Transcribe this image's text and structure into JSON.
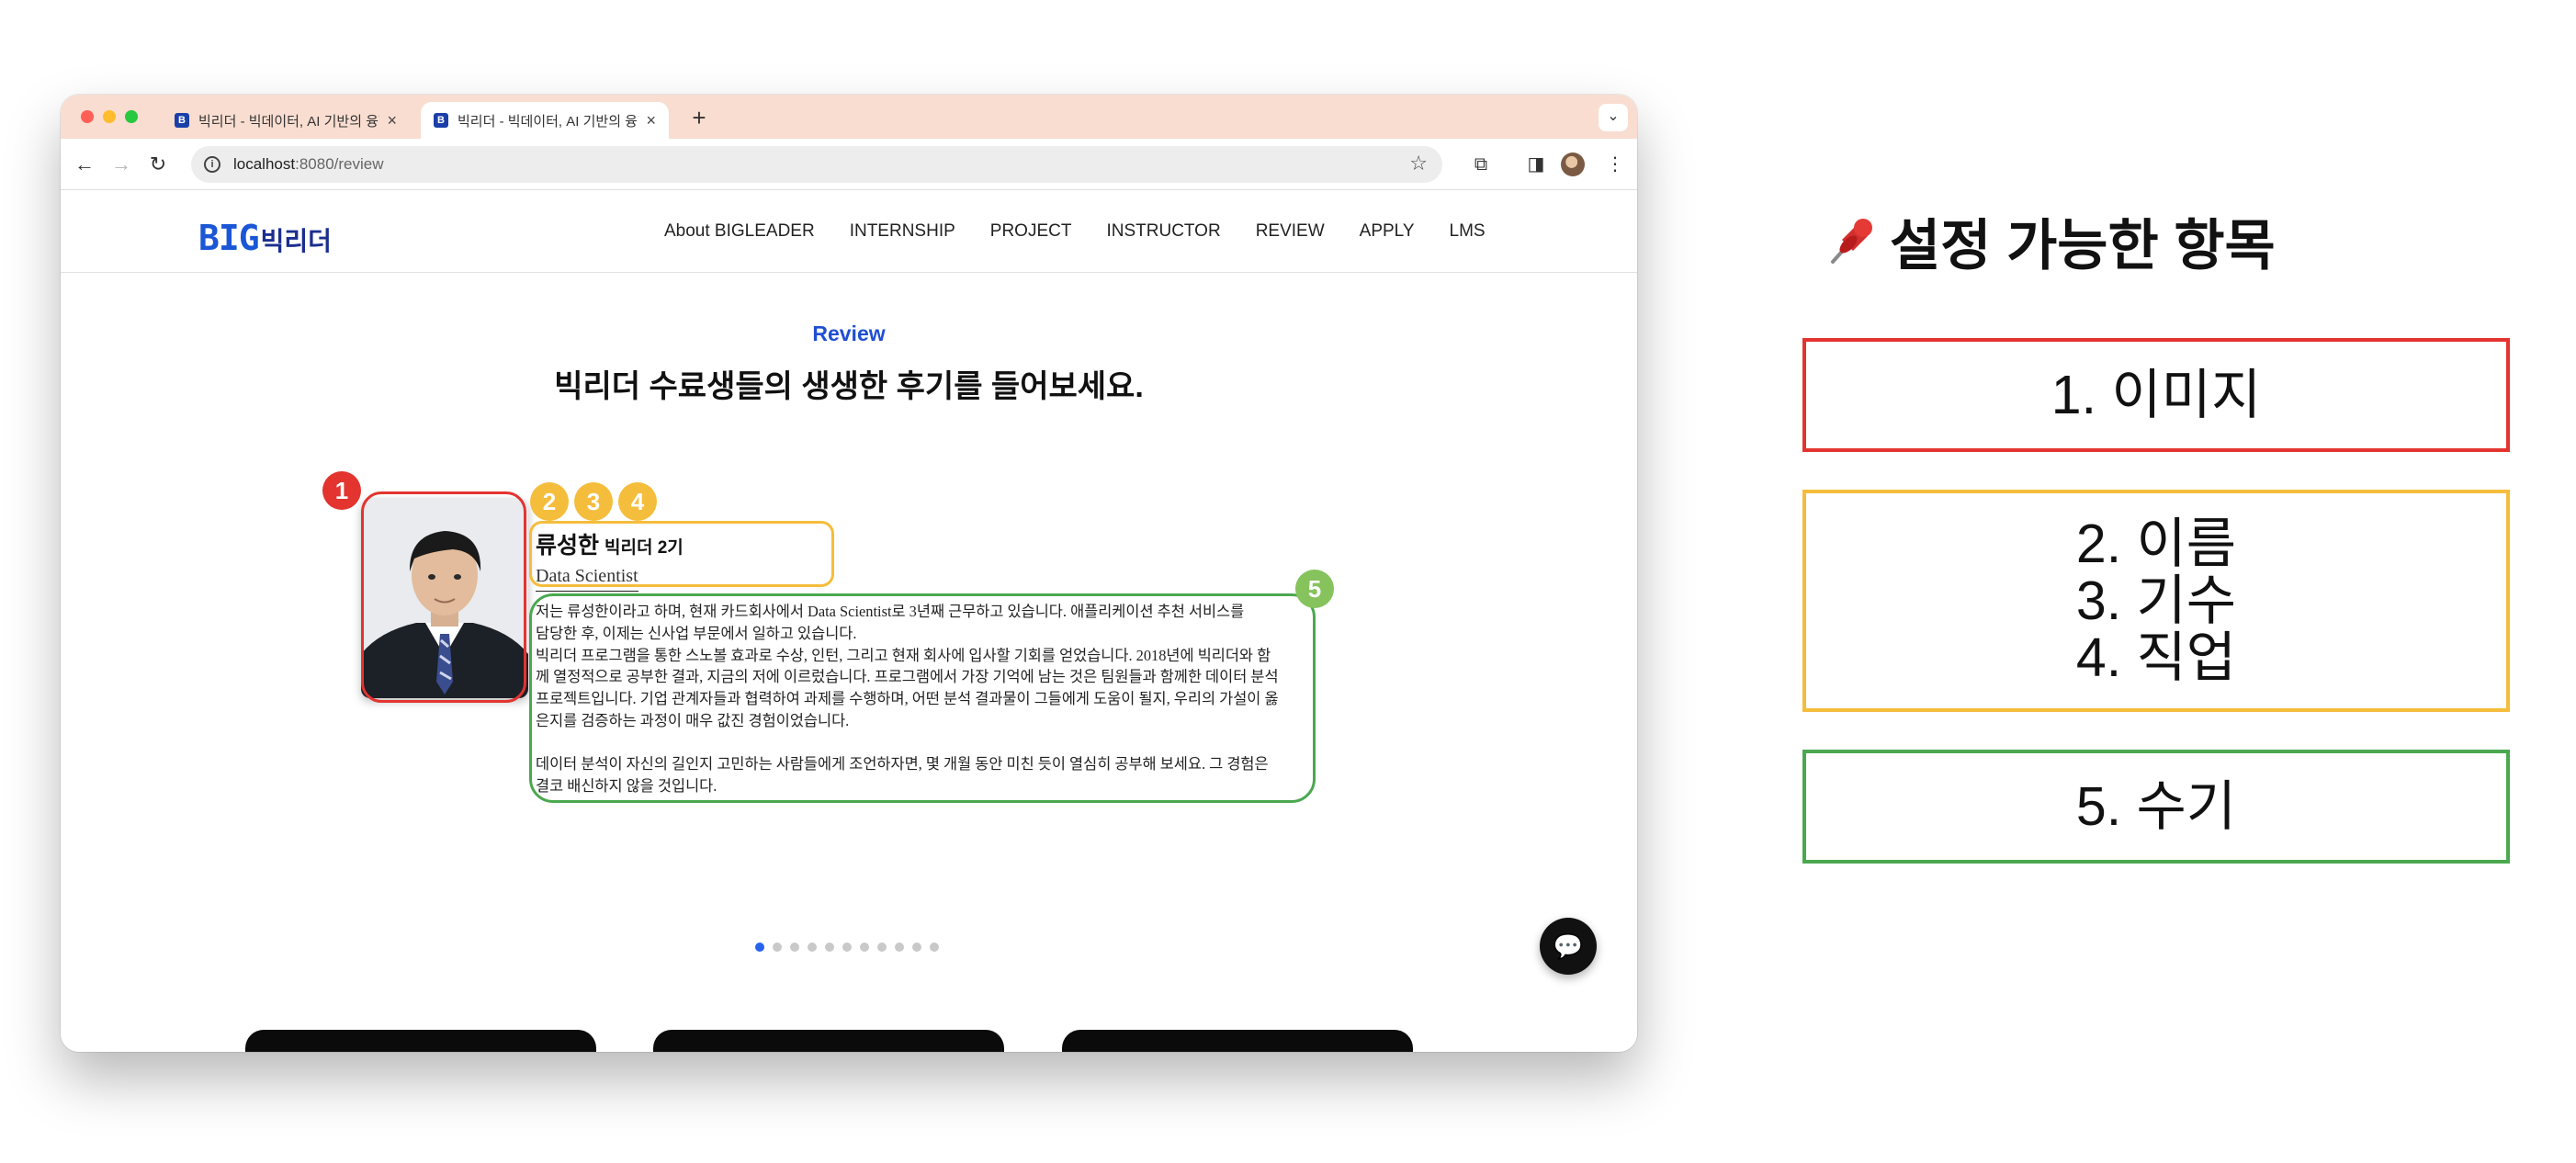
{
  "browser": {
    "tabs": [
      {
        "title": "빅리더 - 빅데이터, AI 기반의 융합",
        "favicon": "B"
      },
      {
        "title": "빅리더 - 빅데이터, AI 기반의 융합",
        "favicon": "B"
      }
    ],
    "url_host": "localhost",
    "url_path": ":8080/review"
  },
  "site": {
    "logo_big": "BIG",
    "logo_kr": "빅리더",
    "nav": [
      "About BIGLEADER",
      "INTERNSHIP",
      "PROJECT",
      "INSTRUCTOR",
      "REVIEW",
      "APPLY",
      "LMS"
    ]
  },
  "review_section": {
    "label": "Review",
    "title": "빅리더 수료생들의 생생한 후기를 들어보세요.",
    "person": {
      "name": "류성한",
      "generation": "빅리더 2기",
      "job": "Data Scientist",
      "review_lines": [
        "저는 류성한이라고 하며, 현재 카드회사에서 Data Scientist로 3년째 근무하고 있습니다. 애플리케이션 추천 서비스를",
        "담당한 후, 이제는 신사업 부문에서 일하고 있습니다.",
        "빅리더 프로그램을 통한 스노볼 효과로 수상, 인턴, 그리고 현재 회사에 입사할 기회를 얻었습니다. 2018년에 빅리더와 함",
        "께 열정적으로 공부한 결과, 지금의 저에 이르렀습니다. 프로그램에서 가장 기억에 남는 것은 팀원들과 함께한 데이터 분석",
        "프로젝트입니다. 기업 관계자들과 협력하여 과제를 수행하며, 어떤 분석 결과물이 그들에게 도움이 될지, 우리의 가설이 옳",
        "은지를 검증하는 과정이 매우 값진 경험이었습니다.",
        "",
        "데이터 분석이 자신의 길인지 고민하는 사람들에게 조언하자면, 몇 개월 동안 미친 듯이 열심히 공부해 보세요. 그 경험은",
        "결코 배신하지 않을 것입니다."
      ]
    },
    "carousel": {
      "total": 11,
      "active": 0
    }
  },
  "annotations": {
    "badges": [
      "1",
      "2",
      "3",
      "4",
      "5"
    ],
    "colors": {
      "image": "#e3342f",
      "profile": "#f5bd3c",
      "review": "#4aa84f"
    }
  },
  "legend": {
    "title": "설정 가능한 항목",
    "title_icon": "pushpin-icon",
    "groups": [
      {
        "lines": [
          "1. 이미지"
        ]
      },
      {
        "lines": [
          "2. 이름",
          "3. 기수",
          "4. 직업"
        ]
      },
      {
        "lines": [
          "5. 수기"
        ]
      }
    ]
  }
}
